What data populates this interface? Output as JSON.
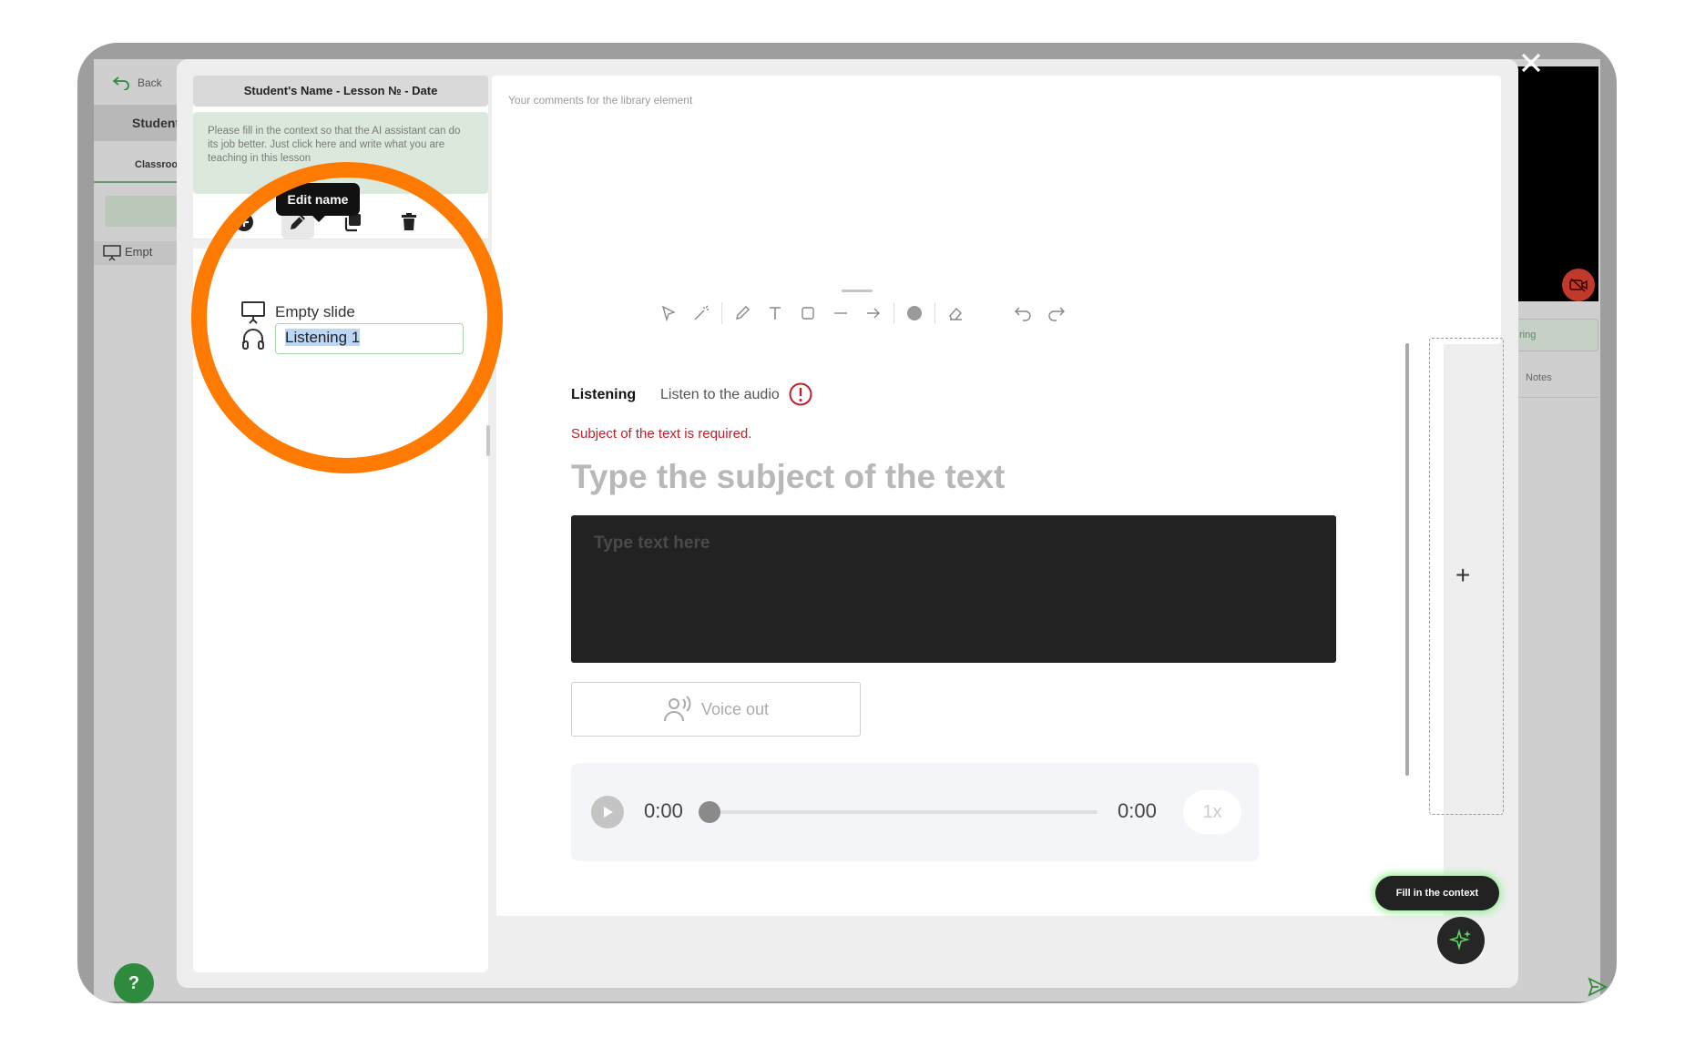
{
  "background_app": {
    "back_label": "Back",
    "student_tab": "Student",
    "classroom_tab": "Classroo",
    "empty_item": "Empt",
    "right_tab1": "ring",
    "right_tab2": "Notes",
    "help_label": "?"
  },
  "modal": {
    "lesson_title": "Student's Name - Lesson № - Date",
    "context_prompt": "Please fill in the context so that the AI assistant can do its job better. Just click here and write what you are teaching in this lesson",
    "tooltip_edit_name": "Edit name",
    "slides": [
      {
        "label": "Empty slide",
        "icon": "presentation-icon"
      },
      {
        "label": "Listening 1",
        "icon": "headphones-icon",
        "editing": true
      }
    ],
    "comments_placeholder": "Your comments for the library element",
    "slide": {
      "tab_active": "Listening",
      "tab_secondary": "Listen to the audio",
      "error_text": "Subject of the text is required.",
      "subject_placeholder": "Type the subject of the text",
      "text_placeholder": "Type text here",
      "voice_out_label": "Voice out",
      "player": {
        "current_time": "0:00",
        "duration": "0:00",
        "speed": "1x",
        "progress": 0
      }
    },
    "add_label": "+",
    "fill_context_label": "Fill in the context"
  },
  "colors": {
    "highlight_ring": "#ff7a00",
    "error": "#c0202a",
    "help_green": "#2e8b3e",
    "glow": "#9ff29f"
  }
}
